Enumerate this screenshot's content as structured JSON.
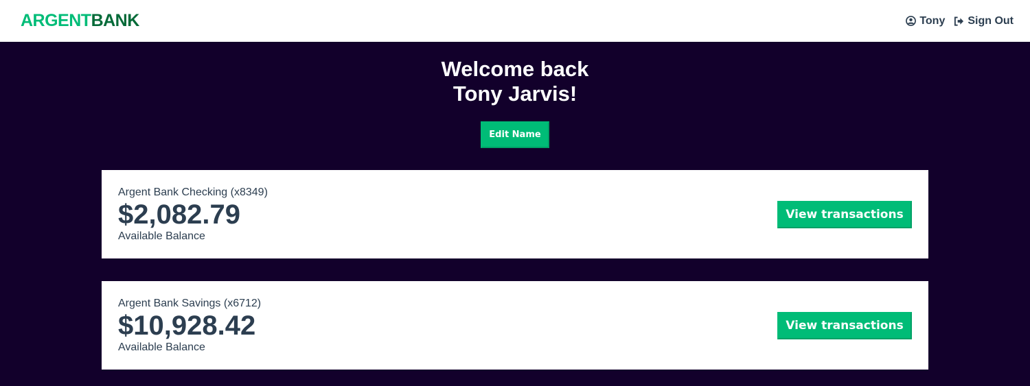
{
  "nav": {
    "logo_part1": "ARGENT",
    "logo_part2": "BANK",
    "user_label": "Tony",
    "signout_label": "Sign Out"
  },
  "header": {
    "line1": "Welcome back",
    "line2": "Tony Jarvis!",
    "edit_label": "Edit Name"
  },
  "accounts": [
    {
      "title": "Argent Bank Checking (x8349)",
      "amount": "$2,082.79",
      "description": "Available Balance",
      "button": "View transactions"
    },
    {
      "title": "Argent Bank Savings (x6712)",
      "amount": "$10,928.42",
      "description": "Available Balance",
      "button": "View transactions"
    }
  ],
  "colors": {
    "brand_green": "#00bc77",
    "brand_dark_green": "#046a38",
    "background": "#12002b",
    "text": "#2c3e50"
  },
  "icons": {
    "user": "user-circle-icon",
    "signout": "sign-out-icon"
  }
}
